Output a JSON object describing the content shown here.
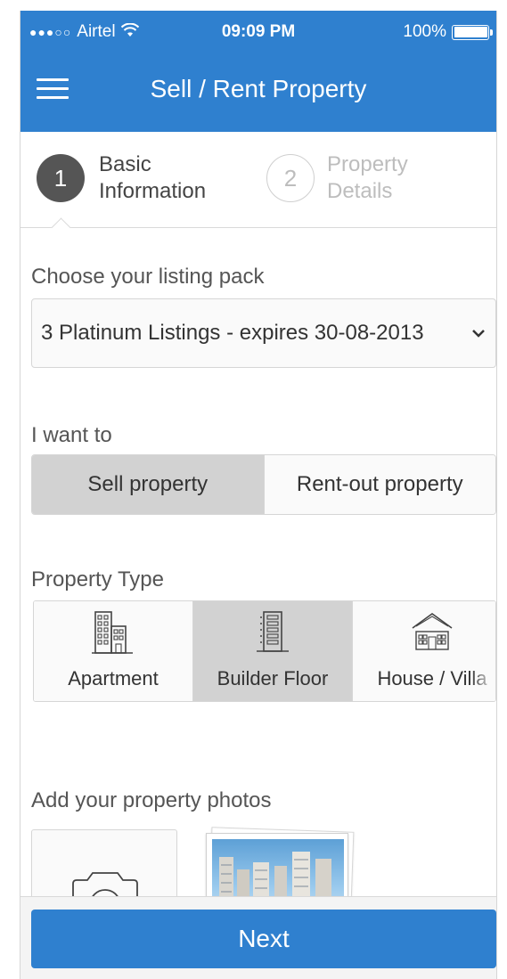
{
  "status_bar": {
    "signal_dots": "●●●○○",
    "carrier": "Airtel",
    "wifi_icon": "wifi-icon",
    "time": "09:09 PM",
    "battery_percent": "100%"
  },
  "nav": {
    "menu_icon": "hamburger-menu-icon",
    "title": "Sell / Rent Property"
  },
  "stepper": {
    "steps": [
      {
        "number": "1",
        "label_line1": "Basic",
        "label_line2": "Information",
        "state": "active"
      },
      {
        "number": "2",
        "label_line1": "Property",
        "label_line2": "Details",
        "state": "inactive"
      }
    ]
  },
  "form": {
    "listing_pack": {
      "label": "Choose your listing pack",
      "selected": "3 Platinum Listings - expires 30-08-2013"
    },
    "intent": {
      "label": "I want to",
      "options": [
        "Sell property",
        "Rent-out property"
      ],
      "selected": "Sell property"
    },
    "property_type": {
      "label": "Property Type",
      "options": [
        {
          "label": "Apartment",
          "icon": "apartment-building-icon"
        },
        {
          "label": "Builder Floor",
          "icon": "builder-floor-building-icon"
        },
        {
          "label": "House / Villa",
          "icon": "house-icon"
        }
      ],
      "selected": "Builder Floor"
    },
    "photos": {
      "label": "Add your property photos",
      "add_icon": "camera-icon"
    }
  },
  "footer": {
    "next_label": "Next"
  },
  "colors": {
    "primary": "#2f80cf",
    "selected_bg": "#d2d2d2",
    "border": "#d6d6d6"
  }
}
